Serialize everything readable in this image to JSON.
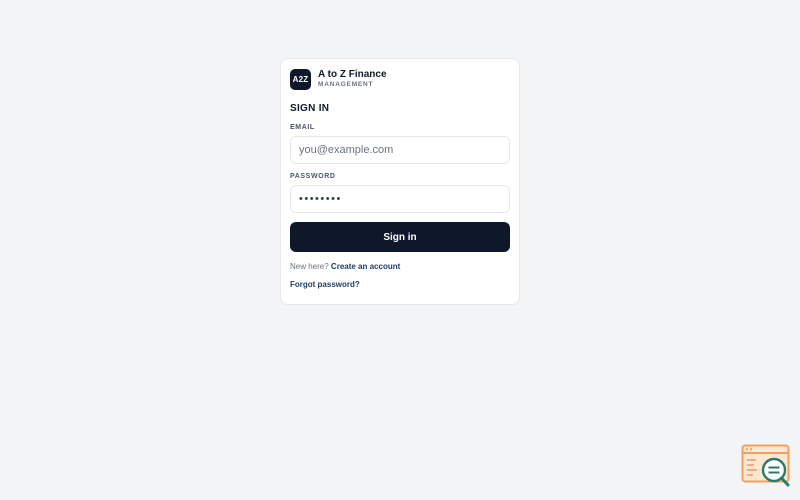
{
  "brand": {
    "logo_text": "A2Z",
    "name": "A to Z Finance",
    "subtitle": "MANAGEMENT"
  },
  "form": {
    "heading": "SIGN IN",
    "email_label": "EMAIL",
    "email_placeholder": "you@example.com",
    "password_label": "PASSWORD",
    "password_value": "••••••••",
    "submit_label": "Sign in",
    "new_here_text": "New here?",
    "create_account_link": "Create an account",
    "forgot_password_link": "Forgot password?"
  },
  "colors": {
    "background": "#f3f4f6",
    "card": "#ffffff",
    "primary": "#0f172a",
    "link": "#1e3a5f",
    "corner_icon_orange": "#f0a060",
    "corner_icon_teal": "#2a7a6a"
  },
  "icons": {
    "corner": "search-document-icon"
  }
}
